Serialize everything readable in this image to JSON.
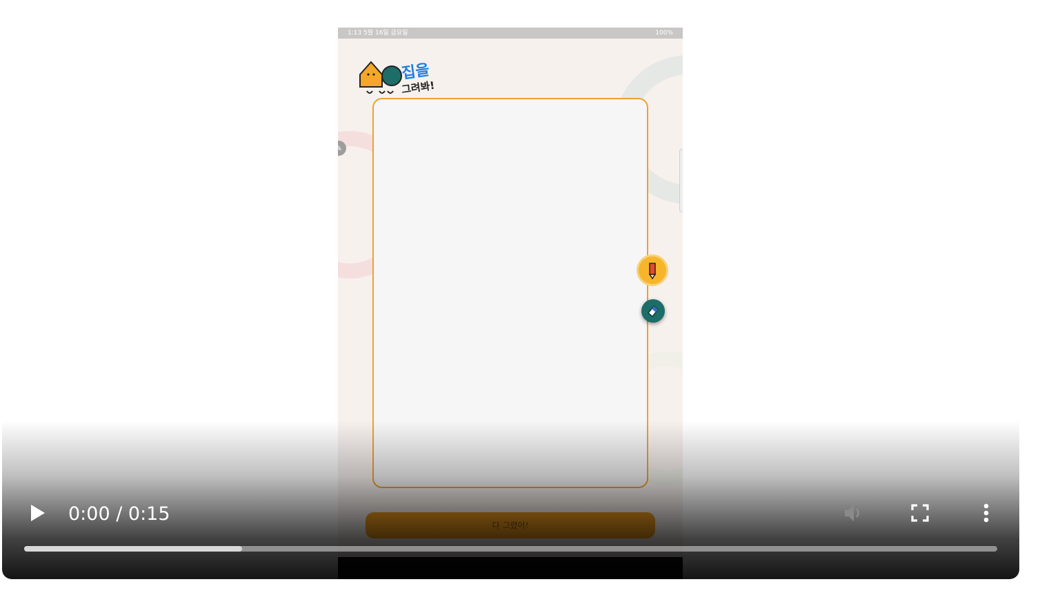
{
  "video": {
    "current_time": "0:00",
    "separator": " / ",
    "duration": "0:15",
    "buffered_fraction": 0.224,
    "state": "paused"
  },
  "controls": {
    "play_icon": "play-icon",
    "volume_icon": "volume-icon",
    "fullscreen_icon": "fullscreen-icon",
    "more_icon": "more-vert-icon"
  },
  "app": {
    "status_left": "1:13  5월 16일 금요일",
    "status_right": "100%",
    "title_line1": "집을",
    "title_line2": "그려봐!",
    "done_button": "다 그렸어!"
  },
  "colors": {
    "canvas_border": "#f0a02a",
    "accent_orange": "#f29d1c",
    "eraser_teal": "#1d6d68",
    "title_blue": "#1f7fe0"
  }
}
